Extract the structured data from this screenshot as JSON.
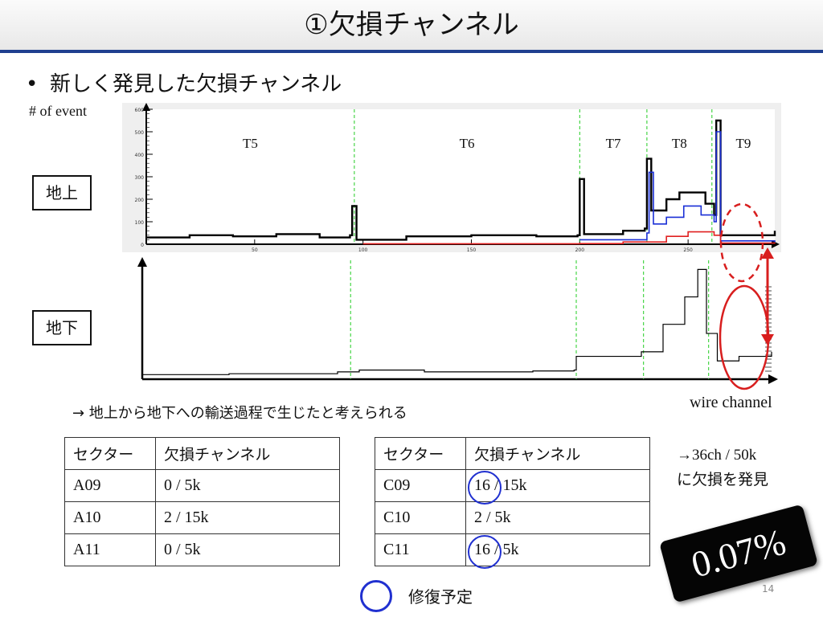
{
  "title": "①欠損チャンネル",
  "bullet": "新しく発見した欠損チャンネル",
  "y_axis_label": "# of event",
  "label_ground": "地上",
  "label_underground": "地下",
  "x_axis_label": "wire channel",
  "sections": [
    "T5",
    "T6",
    "T7",
    "T8",
    "T9"
  ],
  "conclusion": "→ 地上から地下への輸送過程で生じたと考えられる",
  "table_left": {
    "headers": [
      "セクター",
      "欠損チャンネル"
    ],
    "rows": [
      [
        "A09",
        "0 / 5k"
      ],
      [
        "A10",
        "2 / 15k"
      ],
      [
        "A11",
        "0 / 5k"
      ]
    ]
  },
  "table_right": {
    "headers": [
      "セクター",
      "欠損チャンネル"
    ],
    "rows": [
      [
        "C09",
        "16 / 15k"
      ],
      [
        "C10",
        "2 / 5k"
      ],
      [
        "C11",
        "16 / 5k"
      ]
    ]
  },
  "note_line1": "→36ch / 50k",
  "note_line2": "に欠損を発見",
  "badge": "0.07%",
  "legend_text": "修復予定",
  "page_number": "14",
  "colors": {
    "title_rule": "#1f3f8f",
    "circle": "#2030d0",
    "red": "#d81e1e",
    "green_divider": "#22cc22"
  },
  "chart_data": [
    {
      "type": "line",
      "panel": "地上",
      "xlim": [
        0,
        290
      ],
      "ylim": [
        0,
        600
      ],
      "yticks": [
        "0",
        "100",
        "200",
        "300",
        "400",
        "500",
        "600"
      ],
      "xticks": [
        "50",
        "100",
        "150",
        "200",
        "250"
      ],
      "dividers": [
        96,
        200,
        231,
        261
      ],
      "series": [
        {
          "color": "black",
          "points": [
            [
              0,
              30
            ],
            [
              20,
              40
            ],
            [
              40,
              35
            ],
            [
              60,
              45
            ],
            [
              80,
              30
            ],
            [
              94,
              40
            ],
            [
              95,
              170
            ],
            [
              97,
              20
            ],
            [
              120,
              35
            ],
            [
              150,
              40
            ],
            [
              180,
              35
            ],
            [
              199,
              40
            ],
            [
              200,
              290
            ],
            [
              202,
              45
            ],
            [
              220,
              60
            ],
            [
              230,
              70
            ],
            [
              231,
              380
            ],
            [
              233,
              150
            ],
            [
              240,
              200
            ],
            [
              246,
              230
            ],
            [
              252,
              230
            ],
            [
              258,
              180
            ],
            [
              262,
              130
            ],
            [
              263,
              550
            ],
            [
              265,
              40
            ],
            [
              290,
              60
            ]
          ]
        },
        {
          "color": "blue",
          "points": [
            [
              200,
              20
            ],
            [
              231,
              50
            ],
            [
              232,
              320
            ],
            [
              234,
              90
            ],
            [
              240,
              120
            ],
            [
              248,
              170
            ],
            [
              256,
              130
            ],
            [
              262,
              100
            ],
            [
              263,
              500
            ],
            [
              265,
              15
            ],
            [
              290,
              10
            ]
          ]
        },
        {
          "color": "red",
          "points": [
            [
              100,
              2
            ],
            [
              200,
              3
            ],
            [
              220,
              10
            ],
            [
              240,
              35
            ],
            [
              250,
              55
            ],
            [
              262,
              40
            ],
            [
              265,
              5
            ],
            [
              290,
              3
            ]
          ]
        }
      ]
    },
    {
      "type": "line",
      "panel": "地下",
      "series": [
        {
          "color": "black",
          "points": [
            [
              0,
              5
            ],
            [
              40,
              6
            ],
            [
              90,
              8
            ],
            [
              100,
              10
            ],
            [
              130,
              8
            ],
            [
              180,
              9
            ],
            [
              199,
              10
            ],
            [
              200,
              25
            ],
            [
              230,
              30
            ],
            [
              240,
              60
            ],
            [
              250,
              90
            ],
            [
              256,
              120
            ],
            [
              260,
              50
            ],
            [
              265,
              20
            ],
            [
              275,
              25
            ],
            [
              290,
              30
            ]
          ]
        }
      ]
    }
  ]
}
